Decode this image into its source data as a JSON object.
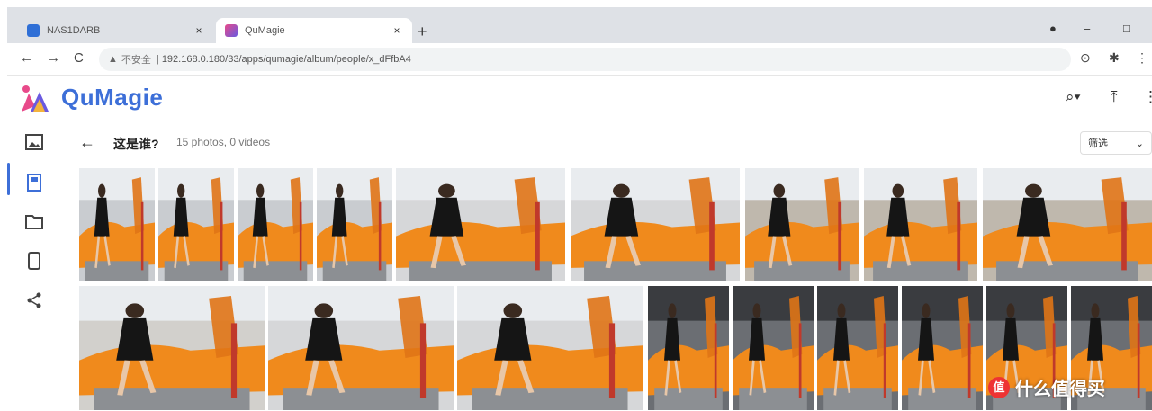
{
  "browser": {
    "tabs": [
      {
        "label": "NAS1DARB",
        "close": "×"
      },
      {
        "label": "QuMagie",
        "close": "×"
      }
    ],
    "new_tab": "+",
    "window_controls": [
      "–",
      "□"
    ],
    "nav": {
      "back": "←",
      "forward": "→",
      "reload": "C"
    },
    "insecure_label": "不安全",
    "url": "192.168.0.180/33/apps/qumagie/album/people/x_dFfbA4"
  },
  "app": {
    "brand": "QuMagie",
    "brand_color": "#3d6fd8",
    "header_icons": [
      "search-icon",
      "upload-icon",
      "more-icon"
    ]
  },
  "sidebar": {
    "items": [
      {
        "icon": "photos-icon"
      },
      {
        "icon": "album-icon",
        "active": true
      },
      {
        "icon": "folder-icon"
      },
      {
        "icon": "device-icon"
      },
      {
        "icon": "share-icon"
      }
    ]
  },
  "album": {
    "back": "←",
    "title": "这是谁?",
    "count": "15 photos, 0 videos",
    "sort_label": "筛选"
  },
  "watermark": {
    "badge": "值",
    "text": "什么值得买"
  }
}
